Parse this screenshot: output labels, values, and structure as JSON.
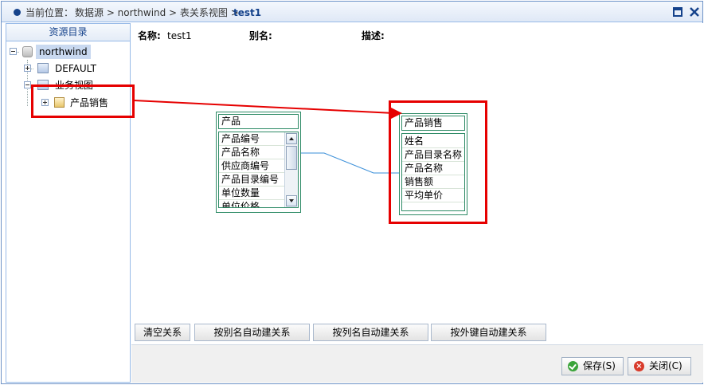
{
  "breadcrumb": {
    "prefix": "当前位置：",
    "path": "数据源 > northwind > 表关系视图 >",
    "current": "test1"
  },
  "sidebar": {
    "header": "资源目录",
    "tree": {
      "root": "northwind",
      "nodes": [
        "DEFAULT",
        "业务视图"
      ],
      "child": "产品销售"
    }
  },
  "meta": {
    "name_label": "名称:",
    "name_value": "test1",
    "alias_label": "别名:",
    "desc_label": "描述:"
  },
  "tables": {
    "source": {
      "title": "产品",
      "fields": [
        "产品编号",
        "产品名称",
        "供应商编号",
        "产品目录编号",
        "单位数量",
        "单位价格"
      ]
    },
    "target": {
      "title": "产品销售",
      "fields": [
        "姓名",
        "产品目录名称",
        "产品名称",
        "销售额",
        "平均单价"
      ]
    }
  },
  "actions": {
    "clear": "清空关系",
    "by_alias": "按别名自动建关系",
    "by_column": "按列名自动建关系",
    "by_fk": "按外键自动建关系"
  },
  "footer": {
    "save": "保存(S)",
    "close": "关闭(C)"
  },
  "colors": {
    "annotation": "#e60000",
    "relation_line": "#3a8fd9",
    "table_border": "#2e8b66"
  }
}
